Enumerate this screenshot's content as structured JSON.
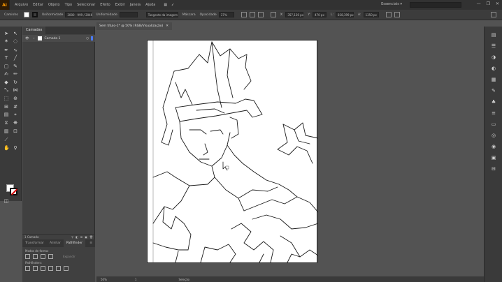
{
  "menubar": {
    "logo": "Ai",
    "items": [
      "Arquivo",
      "Editar",
      "Objeto",
      "Tipo",
      "Selecionar",
      "Efeito",
      "Exibir",
      "Janela",
      "Ajuda"
    ],
    "workspace": "Essenciais",
    "window_controls": [
      "—",
      "❐",
      "✕"
    ]
  },
  "controlbar": {
    "selection": "Caminho",
    "style_label": "Uniformidade",
    "style_value": "3000 - 999 / 2046",
    "brush_label": "Uniformidade",
    "opacity_field": "Tangente da imagem",
    "mask_label": "Máscara",
    "opacity_label": "Opacidade",
    "opacity_value": "37%",
    "x_value": "357,136 px",
    "y_value": "470 px",
    "w_value": "818,399 px",
    "h_value": "1350 px"
  },
  "layers": {
    "tab": "Camadas",
    "layer_name": "Camada 1",
    "footer": "1 Camada"
  },
  "pathfinder": {
    "tabs": [
      "Transformar",
      "Alinhar",
      "Pathfinder"
    ],
    "shape_modes_label": "Modos de forma:",
    "expand_label": "Expandir",
    "pathfinders_label": "Pathfinders:"
  },
  "document": {
    "tab_title": "Sem título-1* @ 50% (RGB/Visualização)",
    "close": "✕"
  },
  "statusbar": {
    "zoom": "50%",
    "page": "1",
    "tool": "Seleção"
  },
  "colors": {
    "accent": "#ff9a00",
    "stroke": "#111111",
    "none_slash": "#d40000",
    "artboard": "#ffffff",
    "canvas": "#535353"
  },
  "icons": {
    "toolbar": [
      "selection-icon",
      "direct-selection-icon",
      "magic-wand-icon",
      "lasso-icon",
      "pen-icon",
      "curvature-icon",
      "type-icon",
      "line-icon",
      "rectangle-icon",
      "paintbrush-icon",
      "shaper-icon",
      "pencil-icon",
      "eraser-icon",
      "rotate-icon",
      "scale-icon",
      "width-icon",
      "free-transform-icon",
      "shape-builder-icon",
      "perspective-icon",
      "mesh-icon",
      "gradient-icon",
      "eyedropper-icon",
      "blend-icon",
      "symbol-sprayer-icon",
      "graph-icon",
      "artboard-icon",
      "slice-icon",
      "hand-icon",
      "zoom-icon"
    ]
  }
}
